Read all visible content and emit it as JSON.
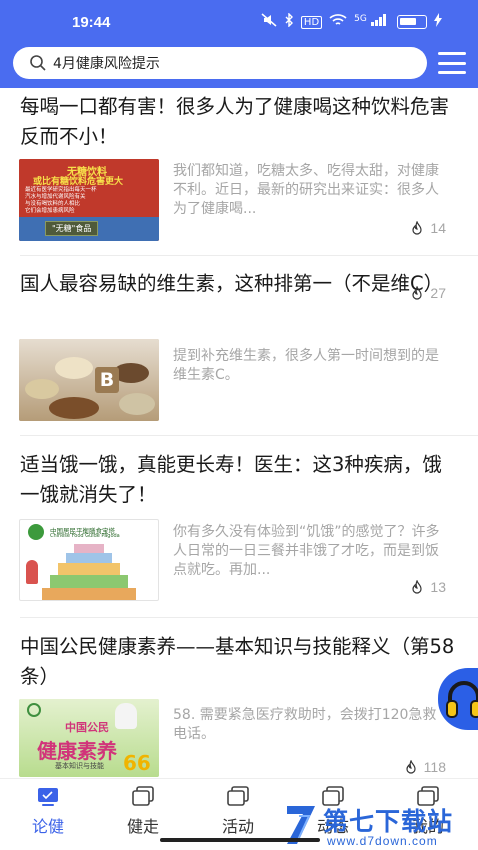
{
  "status_bar": {
    "time": "19:44",
    "icons": [
      "mute-icon",
      "bluetooth-icon",
      "hd-icon",
      "wifi-icon",
      "signal-5g-icon",
      "battery-icon"
    ],
    "hd_label": "HD",
    "network_label": "5G"
  },
  "header": {
    "search_text": "4月健康风险提示",
    "accent_color": "#4a6cf0"
  },
  "articles": [
    {
      "title": "每喝一口都有害！很多人为了健康喝这种饮料危害反而不小！",
      "excerpt": "我们都知道，吃糖太多、吃得太甜，对健康不利。近日，最新的研究出来证实：很多人为了健康喝...",
      "likes": "14",
      "thumb": {
        "heading": "无糖饮料",
        "subheading": "或比有糖饮料危害更大",
        "lines": [
          "最近有医学研究指出每天一杯",
          "汽水与增加代谢风险有关",
          "与没有喝饮料的人相比",
          "它们会增加患病风险"
        ],
        "tag": "\"无糖\"食品"
      }
    },
    {
      "title": "国人最容易缺的维生素，这种排第一（不是维C）",
      "excerpt": "提到补充维生素，很多人第一时间想到的是维生素C。",
      "likes": "27",
      "thumb": {
        "badge": "B"
      }
    },
    {
      "title": "适当饿一饿，真能更长寿！医生：这3种疾病，饿一饿就消失了！",
      "excerpt": "你有多久没有体验到“饥饿”的感觉了？许多人日常的一日三餐并非饿了才吃，而是到饭点就吃。再加...",
      "likes": "13",
      "thumb": {
        "heading": "中国居民平衡膳食宝塔",
        "subheading": "Chinese Food Guide Pagoda"
      }
    },
    {
      "title": "中国公民健康素养——基本知识与技能释义（第58条）",
      "excerpt": "58. 需要紧急医疗救助时，会拨打120急救电话。",
      "likes": "118",
      "thumb": {
        "top": "中国公民",
        "title": "健康素养",
        "sub": "基本知识与技能",
        "number": "66"
      }
    }
  ],
  "bottom_nav": [
    {
      "label": "论健",
      "icon": "monitor-icon",
      "active": true
    },
    {
      "label": "健走",
      "icon": "screen-icon",
      "active": false
    },
    {
      "label": "活动",
      "icon": "screen-icon",
      "active": false
    },
    {
      "label": "动态",
      "icon": "screen-icon",
      "active": false
    },
    {
      "label": "我的",
      "icon": "screen-icon",
      "active": false
    }
  ],
  "watermark": {
    "text": "第七下载站",
    "url": "www.d7down.com"
  }
}
